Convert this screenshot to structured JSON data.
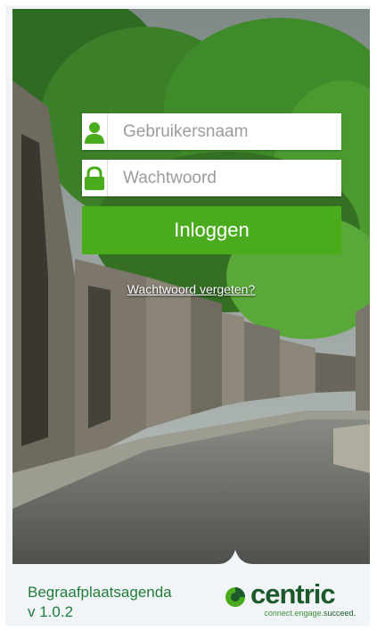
{
  "login": {
    "username_placeholder": "Gebruikersnaam",
    "password_placeholder": "Wachtwoord",
    "submit_label": "Inloggen",
    "forgot_label": "Wachtwoord vergeten?"
  },
  "footer": {
    "app_name": "Begraafplaatsagenda",
    "version": "v 1.0.2",
    "brand": "centric",
    "tagline_a": "connect.engage.",
    "tagline_b": "succeed."
  },
  "colors": {
    "accent": "#4aab1c",
    "brand_dark": "#1c5a2c",
    "app_name": "#1f7d3b"
  },
  "icons": {
    "username": "user-icon",
    "password": "lock-icon",
    "logo_mark": "centric-logo-icon"
  }
}
